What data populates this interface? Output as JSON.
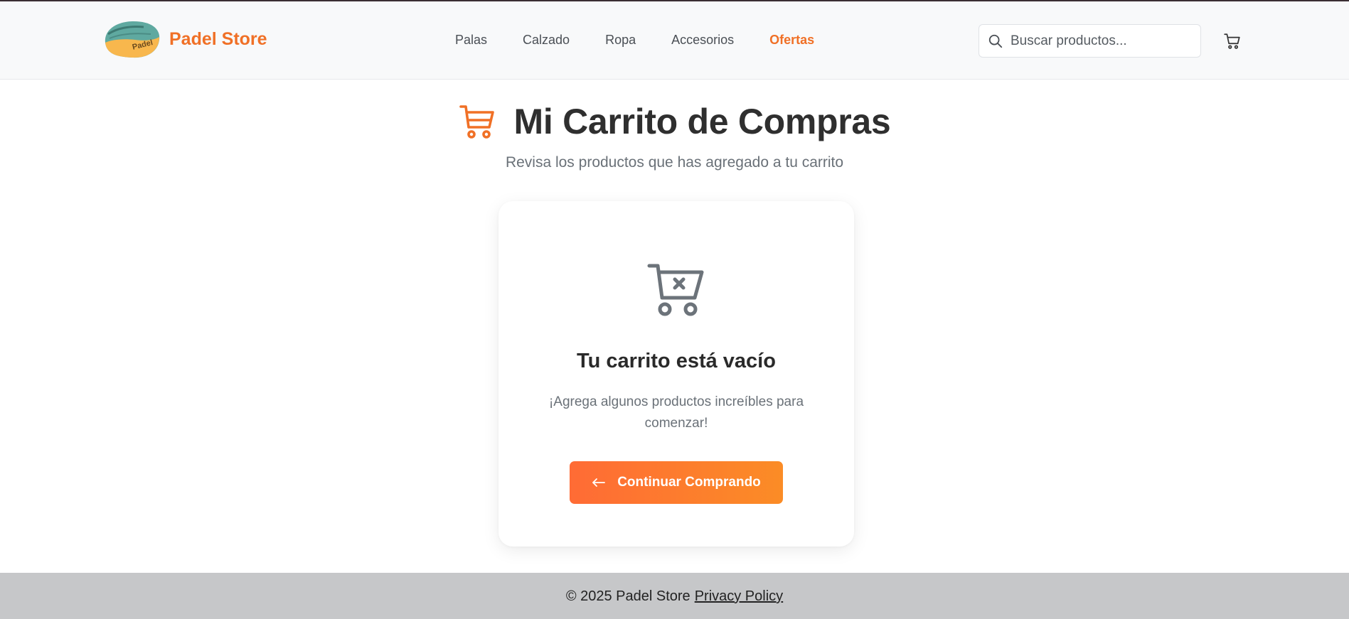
{
  "header": {
    "brand": "Padel Store",
    "logo_text": "Padel",
    "nav": [
      {
        "label": "Palas",
        "active": false
      },
      {
        "label": "Calzado",
        "active": false
      },
      {
        "label": "Ropa",
        "active": false
      },
      {
        "label": "Accesorios",
        "active": false
      },
      {
        "label": "Ofertas",
        "active": true
      }
    ],
    "search": {
      "placeholder": "Buscar productos...",
      "value": "",
      "icon": "search-icon"
    },
    "cart_icon": "cart-icon"
  },
  "page": {
    "title": "Mi Carrito de Compras",
    "title_icon": "cart-icon",
    "subtitle": "Revisa los productos que has agregado a tu carrito"
  },
  "empty_cart": {
    "icon": "cart-x-icon",
    "heading": "Tu carrito está vacío",
    "text": "¡Agrega algunos productos increíbles para comenzar!",
    "button_label": "Continuar Comprando",
    "button_icon": "arrow-left-icon"
  },
  "footer": {
    "copyright": "© 2025 Padel Store",
    "privacy_link": "Privacy Policy"
  },
  "colors": {
    "accent": "#f07026",
    "button_gradient_start": "#ff6b35",
    "button_gradient_end": "#fb8c26",
    "header_bg": "#f8f9fa",
    "footer_bg": "#c6c7c9"
  }
}
